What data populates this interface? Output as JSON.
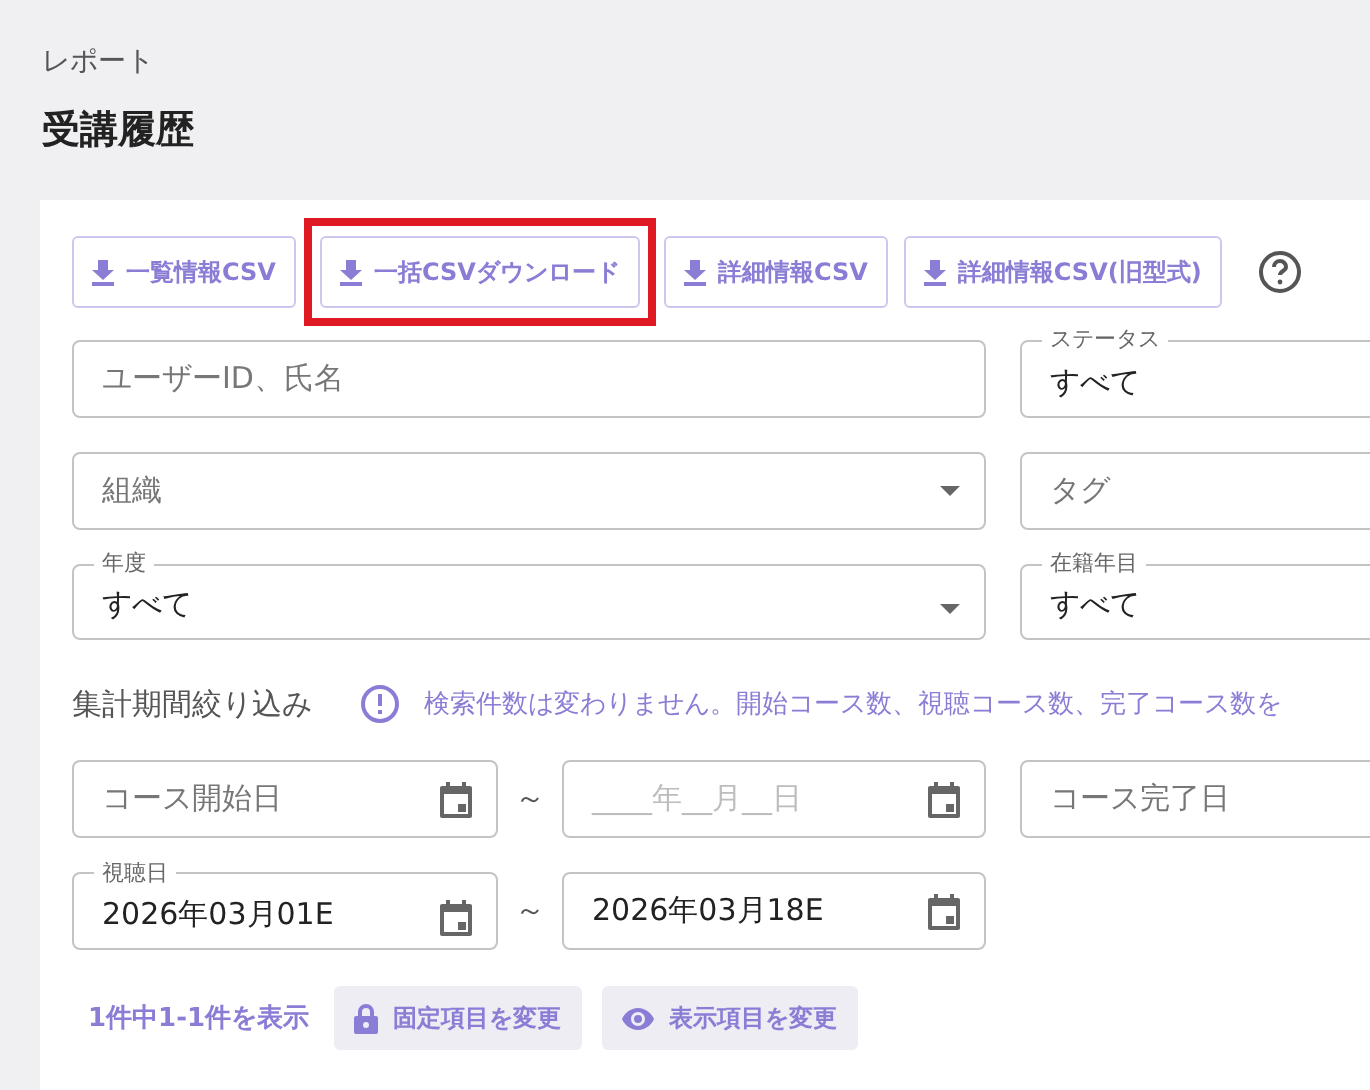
{
  "breadcrumb": "レポート",
  "title": "受講履歴",
  "toolbar": {
    "buttons": [
      {
        "label": "一覧情報CSV",
        "highlighted": false
      },
      {
        "label": "一括CSVダウンロード",
        "highlighted": true
      },
      {
        "label": "詳細情報CSV",
        "highlighted": false
      },
      {
        "label": "詳細情報CSV(旧型式)",
        "highlighted": false
      }
    ]
  },
  "filter_rows": [
    [
      {
        "kind": "input",
        "placeholder": "ユーザーID、氏名"
      },
      {
        "kind": "select",
        "label": "ステータス",
        "value": "すべて"
      }
    ],
    [
      {
        "kind": "select",
        "placeholder": "組織"
      },
      {
        "kind": "input",
        "placeholder": "タグ"
      }
    ],
    [
      {
        "kind": "select",
        "label": "年度",
        "value": "すべて"
      },
      {
        "kind": "select",
        "label": "在籍年目",
        "value": "すべて"
      }
    ]
  ],
  "period_filter": {
    "label": "集計期間絞り込み",
    "notice": "検索件数は変わりません。開始コース数、視聴コース数、完了コース数を"
  },
  "date_ranges": [
    {
      "from": {
        "placeholder": "コース開始日"
      },
      "separator": "～",
      "to": {
        "kind": "masked",
        "placeholder": "____年__月__日"
      },
      "extra": {
        "placeholder": "コース完了日"
      }
    },
    {
      "label": "視聴日",
      "from": {
        "value": "2026年03月01E"
      },
      "separator": "～",
      "to": {
        "value": "2026年03月18E"
      }
    }
  ],
  "results": {
    "count": "1件中1-1件を表示",
    "buttons": [
      {
        "label": "固定項目を変更"
      },
      {
        "label": "表示項目を変更"
      }
    ]
  }
}
